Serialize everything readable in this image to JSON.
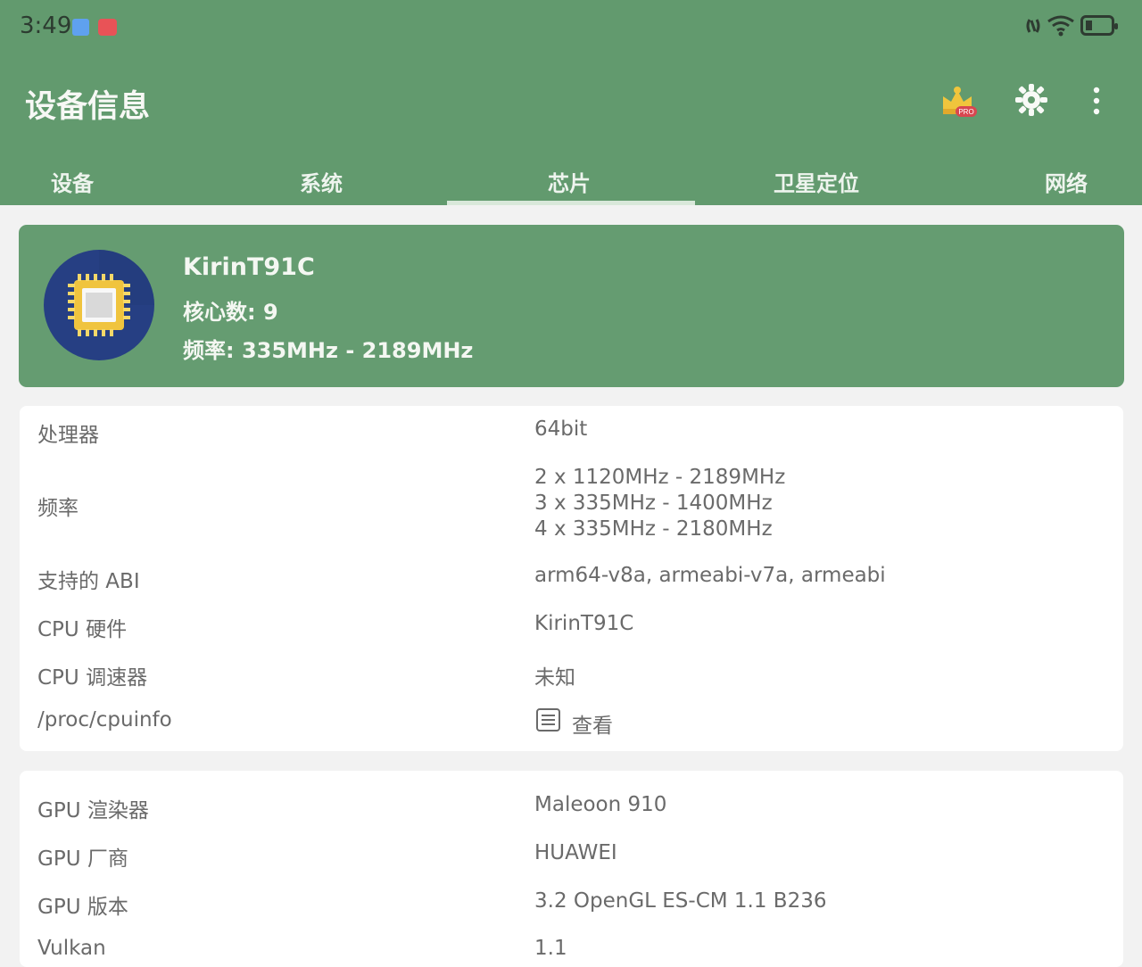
{
  "statusbar": {
    "time": "3:49"
  },
  "header": {
    "title": "设备信息"
  },
  "tabs": [
    {
      "label": "设备"
    },
    {
      "label": "系统"
    },
    {
      "label": "芯片"
    },
    {
      "label": "卫星定位"
    },
    {
      "label": "网络"
    }
  ],
  "hero": {
    "name": "KirinT91C",
    "cores_label": "核心数: 9",
    "freq_label": "频率: 335MHz - 2189MHz"
  },
  "cpu_rows": [
    {
      "label": "处理器",
      "value": "64bit"
    },
    {
      "label": "频率",
      "values": [
        "2 x 1120MHz - 2189MHz",
        "3 x 335MHz - 1400MHz",
        "4 x 335MHz - 2180MHz"
      ]
    },
    {
      "label": "支持的 ABI",
      "value": "arm64-v8a, armeabi-v7a, armeabi"
    },
    {
      "label": "CPU 硬件",
      "value": "KirinT91C"
    },
    {
      "label": "CPU 调速器",
      "value": "未知"
    },
    {
      "label": "/proc/cpuinfo",
      "value": "查看"
    }
  ],
  "gpu_rows": [
    {
      "label": "GPU 渲染器",
      "value": "Maleoon 910"
    },
    {
      "label": "GPU 厂商",
      "value": "HUAWEI"
    },
    {
      "label": "GPU 版本",
      "value": "3.2 OpenGL ES-CM 1.1 B236"
    },
    {
      "label": "Vulkan",
      "value": "1.1"
    }
  ],
  "colors": {
    "primary": "#629a6e",
    "card": "#ffffff",
    "background": "#f2f2f2"
  },
  "icons": [
    "crown-pro-icon",
    "settings-gear-icon",
    "more-vert-icon",
    "cpu-chip-icon",
    "document-icon"
  ]
}
